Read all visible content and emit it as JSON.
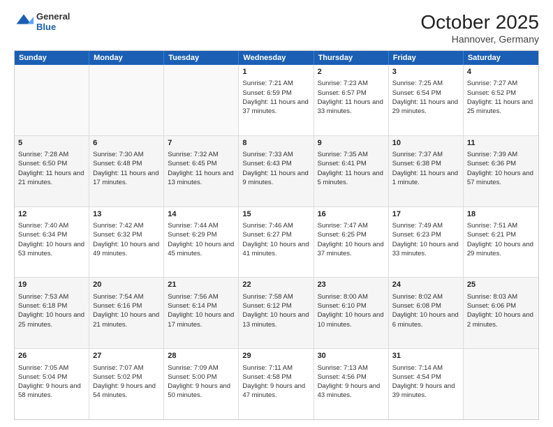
{
  "logo": {
    "general": "General",
    "blue": "Blue"
  },
  "header": {
    "month": "October 2025",
    "location": "Hannover, Germany"
  },
  "days": [
    "Sunday",
    "Monday",
    "Tuesday",
    "Wednesday",
    "Thursday",
    "Friday",
    "Saturday"
  ],
  "weeks": [
    [
      {
        "day": "",
        "empty": true
      },
      {
        "day": "",
        "empty": true
      },
      {
        "day": "",
        "empty": true
      },
      {
        "day": "1",
        "sunrise": "Sunrise: 7:21 AM",
        "sunset": "Sunset: 6:59 PM",
        "daylight": "Daylight: 11 hours and 37 minutes."
      },
      {
        "day": "2",
        "sunrise": "Sunrise: 7:23 AM",
        "sunset": "Sunset: 6:57 PM",
        "daylight": "Daylight: 11 hours and 33 minutes."
      },
      {
        "day": "3",
        "sunrise": "Sunrise: 7:25 AM",
        "sunset": "Sunset: 6:54 PM",
        "daylight": "Daylight: 11 hours and 29 minutes."
      },
      {
        "day": "4",
        "sunrise": "Sunrise: 7:27 AM",
        "sunset": "Sunset: 6:52 PM",
        "daylight": "Daylight: 11 hours and 25 minutes."
      }
    ],
    [
      {
        "day": "5",
        "sunrise": "Sunrise: 7:28 AM",
        "sunset": "Sunset: 6:50 PM",
        "daylight": "Daylight: 11 hours and 21 minutes."
      },
      {
        "day": "6",
        "sunrise": "Sunrise: 7:30 AM",
        "sunset": "Sunset: 6:48 PM",
        "daylight": "Daylight: 11 hours and 17 minutes."
      },
      {
        "day": "7",
        "sunrise": "Sunrise: 7:32 AM",
        "sunset": "Sunset: 6:45 PM",
        "daylight": "Daylight: 11 hours and 13 minutes."
      },
      {
        "day": "8",
        "sunrise": "Sunrise: 7:33 AM",
        "sunset": "Sunset: 6:43 PM",
        "daylight": "Daylight: 11 hours and 9 minutes."
      },
      {
        "day": "9",
        "sunrise": "Sunrise: 7:35 AM",
        "sunset": "Sunset: 6:41 PM",
        "daylight": "Daylight: 11 hours and 5 minutes."
      },
      {
        "day": "10",
        "sunrise": "Sunrise: 7:37 AM",
        "sunset": "Sunset: 6:38 PM",
        "daylight": "Daylight: 11 hours and 1 minute."
      },
      {
        "day": "11",
        "sunrise": "Sunrise: 7:39 AM",
        "sunset": "Sunset: 6:36 PM",
        "daylight": "Daylight: 10 hours and 57 minutes."
      }
    ],
    [
      {
        "day": "12",
        "sunrise": "Sunrise: 7:40 AM",
        "sunset": "Sunset: 6:34 PM",
        "daylight": "Daylight: 10 hours and 53 minutes."
      },
      {
        "day": "13",
        "sunrise": "Sunrise: 7:42 AM",
        "sunset": "Sunset: 6:32 PM",
        "daylight": "Daylight: 10 hours and 49 minutes."
      },
      {
        "day": "14",
        "sunrise": "Sunrise: 7:44 AM",
        "sunset": "Sunset: 6:29 PM",
        "daylight": "Daylight: 10 hours and 45 minutes."
      },
      {
        "day": "15",
        "sunrise": "Sunrise: 7:46 AM",
        "sunset": "Sunset: 6:27 PM",
        "daylight": "Daylight: 10 hours and 41 minutes."
      },
      {
        "day": "16",
        "sunrise": "Sunrise: 7:47 AM",
        "sunset": "Sunset: 6:25 PM",
        "daylight": "Daylight: 10 hours and 37 minutes."
      },
      {
        "day": "17",
        "sunrise": "Sunrise: 7:49 AM",
        "sunset": "Sunset: 6:23 PM",
        "daylight": "Daylight: 10 hours and 33 minutes."
      },
      {
        "day": "18",
        "sunrise": "Sunrise: 7:51 AM",
        "sunset": "Sunset: 6:21 PM",
        "daylight": "Daylight: 10 hours and 29 minutes."
      }
    ],
    [
      {
        "day": "19",
        "sunrise": "Sunrise: 7:53 AM",
        "sunset": "Sunset: 6:18 PM",
        "daylight": "Daylight: 10 hours and 25 minutes."
      },
      {
        "day": "20",
        "sunrise": "Sunrise: 7:54 AM",
        "sunset": "Sunset: 6:16 PM",
        "daylight": "Daylight: 10 hours and 21 minutes."
      },
      {
        "day": "21",
        "sunrise": "Sunrise: 7:56 AM",
        "sunset": "Sunset: 6:14 PM",
        "daylight": "Daylight: 10 hours and 17 minutes."
      },
      {
        "day": "22",
        "sunrise": "Sunrise: 7:58 AM",
        "sunset": "Sunset: 6:12 PM",
        "daylight": "Daylight: 10 hours and 13 minutes."
      },
      {
        "day": "23",
        "sunrise": "Sunrise: 8:00 AM",
        "sunset": "Sunset: 6:10 PM",
        "daylight": "Daylight: 10 hours and 10 minutes."
      },
      {
        "day": "24",
        "sunrise": "Sunrise: 8:02 AM",
        "sunset": "Sunset: 6:08 PM",
        "daylight": "Daylight: 10 hours and 6 minutes."
      },
      {
        "day": "25",
        "sunrise": "Sunrise: 8:03 AM",
        "sunset": "Sunset: 6:06 PM",
        "daylight": "Daylight: 10 hours and 2 minutes."
      }
    ],
    [
      {
        "day": "26",
        "sunrise": "Sunrise: 7:05 AM",
        "sunset": "Sunset: 5:04 PM",
        "daylight": "Daylight: 9 hours and 58 minutes."
      },
      {
        "day": "27",
        "sunrise": "Sunrise: 7:07 AM",
        "sunset": "Sunset: 5:02 PM",
        "daylight": "Daylight: 9 hours and 54 minutes."
      },
      {
        "day": "28",
        "sunrise": "Sunrise: 7:09 AM",
        "sunset": "Sunset: 5:00 PM",
        "daylight": "Daylight: 9 hours and 50 minutes."
      },
      {
        "day": "29",
        "sunrise": "Sunrise: 7:11 AM",
        "sunset": "Sunset: 4:58 PM",
        "daylight": "Daylight: 9 hours and 47 minutes."
      },
      {
        "day": "30",
        "sunrise": "Sunrise: 7:13 AM",
        "sunset": "Sunset: 4:56 PM",
        "daylight": "Daylight: 9 hours and 43 minutes."
      },
      {
        "day": "31",
        "sunrise": "Sunrise: 7:14 AM",
        "sunset": "Sunset: 4:54 PM",
        "daylight": "Daylight: 9 hours and 39 minutes."
      },
      {
        "day": "",
        "empty": true
      }
    ]
  ]
}
